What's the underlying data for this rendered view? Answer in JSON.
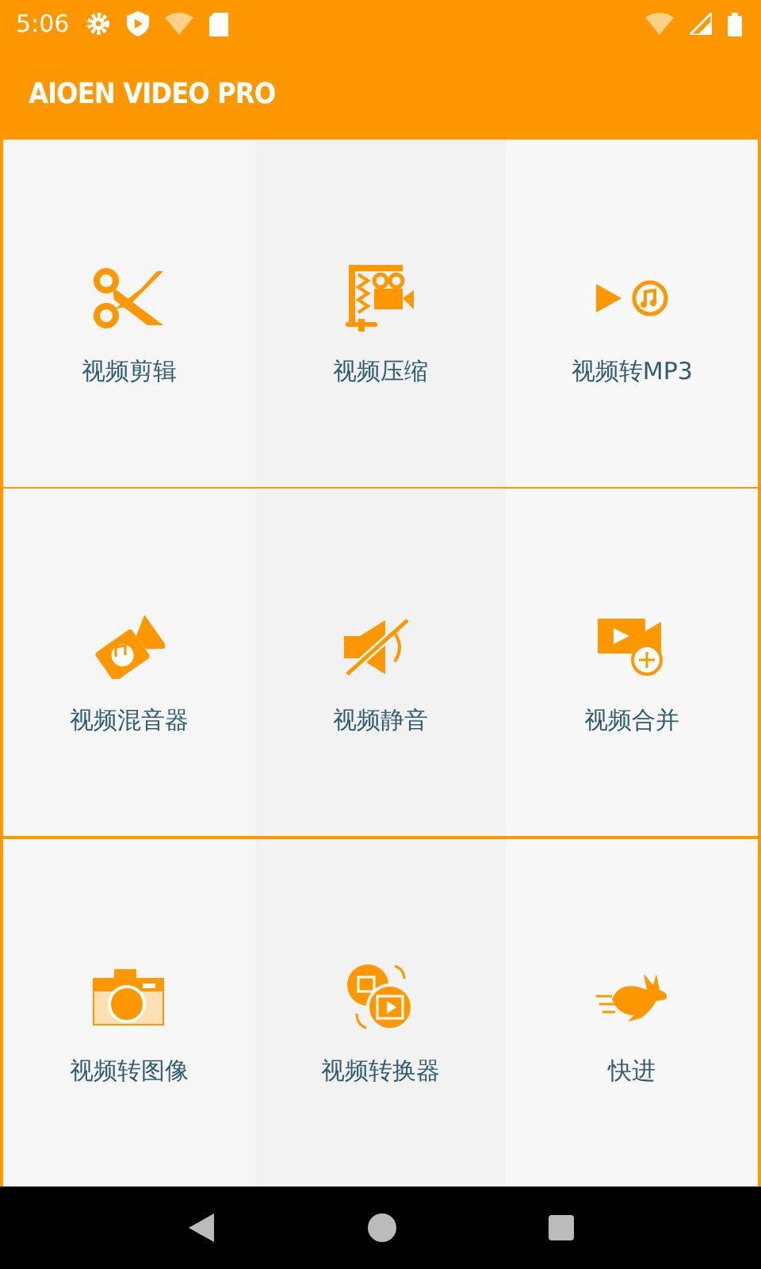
{
  "status_bar": {
    "time": "5:06"
  },
  "app_bar": {
    "title": "AIOEN VIDEO PRO"
  },
  "tools": [
    {
      "kind": "scissors",
      "label": "视频剪辑"
    },
    {
      "kind": "compress",
      "label": "视频压缩"
    },
    {
      "kind": "mp3",
      "label": "视频转MP3"
    },
    {
      "kind": "mixer",
      "label": "视频混音器"
    },
    {
      "kind": "mute",
      "label": "视频静音"
    },
    {
      "kind": "merge",
      "label": "视频合并"
    },
    {
      "kind": "camera",
      "label": "视频转图像"
    },
    {
      "kind": "convert",
      "label": "视频转换器"
    },
    {
      "kind": "rabbit",
      "label": "快进"
    }
  ]
}
